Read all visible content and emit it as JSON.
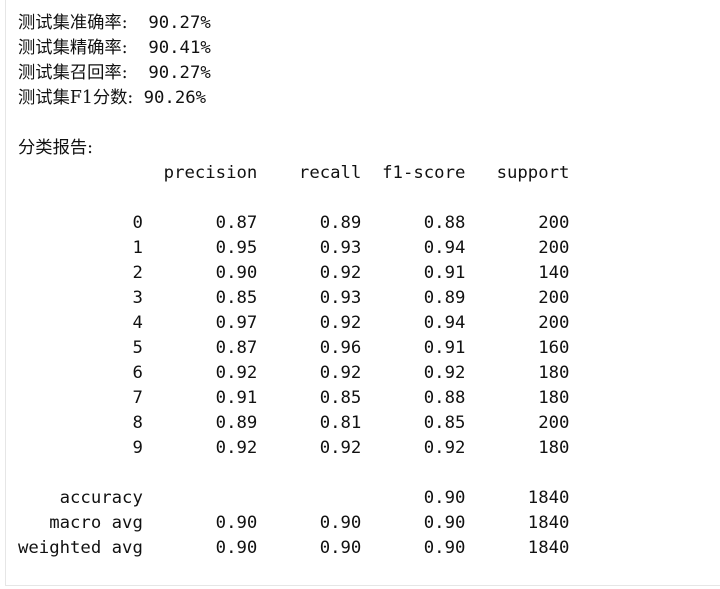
{
  "metrics": [
    {
      "label": "测试集准确率:",
      "gap": "  ",
      "value": "90.27%"
    },
    {
      "label": "测试集精确率:",
      "gap": "  ",
      "value": "90.41%"
    },
    {
      "label": "测试集召回率:",
      "gap": "  ",
      "value": "90.27%"
    },
    {
      "label": "测试集F1分数:",
      "gap": " ",
      "value": "90.26%"
    }
  ],
  "report": {
    "title": "分类报告:",
    "header": "              precision    recall  f1-score   support",
    "class_rows": [
      "           0       0.87      0.89      0.88       200",
      "           1       0.95      0.93      0.94       200",
      "           2       0.90      0.92      0.91       140",
      "           3       0.85      0.93      0.89       200",
      "           4       0.97      0.92      0.94       200",
      "           5       0.87      0.96      0.91       160",
      "           6       0.92      0.92      0.92       180",
      "           7       0.91      0.85      0.88       180",
      "           8       0.89      0.81      0.85       200",
      "           9       0.92      0.92      0.92       180"
    ],
    "summary_rows": [
      "    accuracy                           0.90      1840",
      "   macro avg       0.90      0.90      0.90      1840",
      "weighted avg       0.90      0.90      0.90      1840"
    ]
  }
}
